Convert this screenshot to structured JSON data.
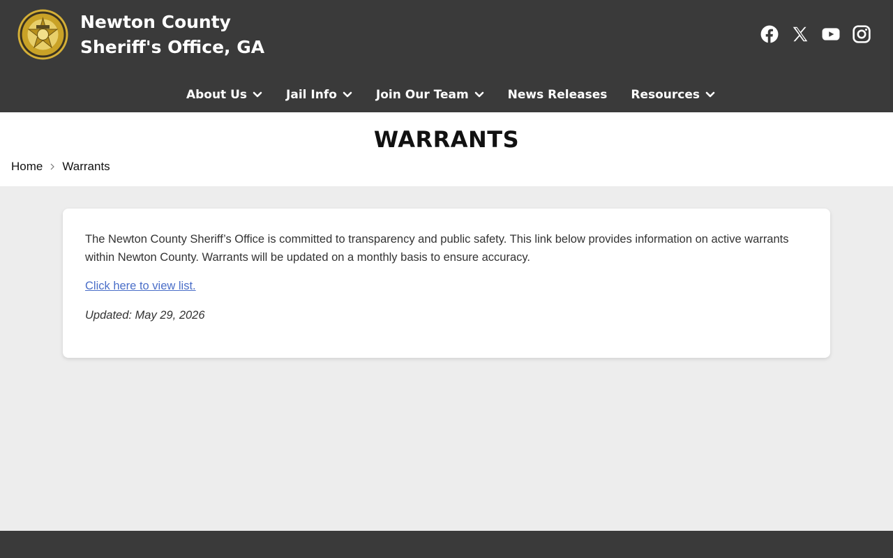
{
  "header": {
    "title_line1": "Newton County",
    "title_line2": "Sheriff's Office, GA",
    "social": [
      "facebook-icon",
      "x-icon",
      "youtube-icon",
      "instagram-icon"
    ]
  },
  "nav": {
    "items": [
      {
        "label": "About Us",
        "has_dropdown": true
      },
      {
        "label": "Jail Info",
        "has_dropdown": true
      },
      {
        "label": "Join Our Team",
        "has_dropdown": true
      },
      {
        "label": "News Releases",
        "has_dropdown": false
      },
      {
        "label": "Resources",
        "has_dropdown": true
      }
    ]
  },
  "page": {
    "title": "WARRANTS",
    "breadcrumb": {
      "home": "Home",
      "current": "Warrants"
    }
  },
  "content": {
    "intro": "The Newton County Sheriff’s Office is committed to transparency and public safety. This link below provides information on active warrants within Newton County. Warrants will be updated on a monthly basis to ensure accuracy.",
    "link_label": "Click here to view list.",
    "updated": "Updated: May 29, 2026"
  },
  "colors": {
    "header_bg": "#3a3a3a",
    "page_bg": "#ededed",
    "link": "#4a6ec8",
    "badge_gold": "#c9a227"
  }
}
